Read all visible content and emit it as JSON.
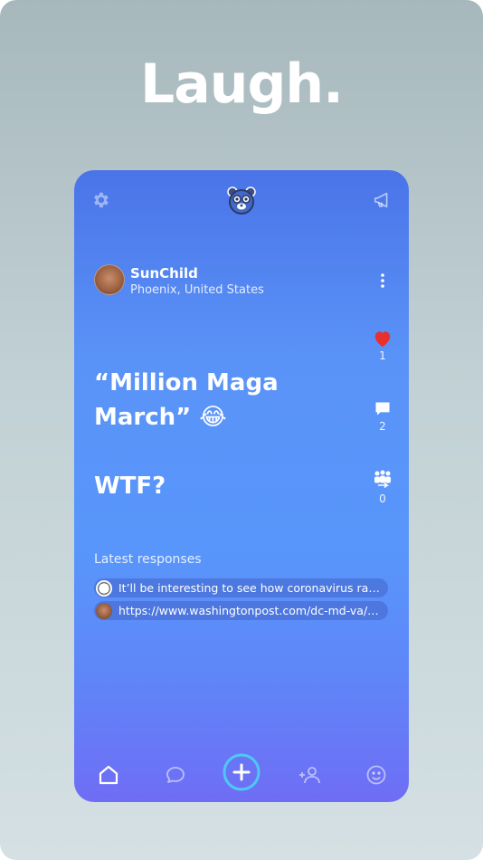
{
  "headline": "Laugh.",
  "topbar": {
    "left_icon": "gear-icon",
    "center_icon": "bear-logo-icon",
    "right_icon": "megaphone-icon"
  },
  "post": {
    "author": {
      "name": "SunChild",
      "location": "Phoenix, United States"
    },
    "text_line1": "“Million Maga",
    "text_line2": "March” 😂",
    "text_line3": "WTF?",
    "actions": {
      "likes": "1",
      "comments": "2",
      "groups": "0"
    }
  },
  "responses": {
    "label": "Latest responses",
    "items": [
      {
        "text": "It’ll be interesting to see how coronavirus rates among those attending…"
      },
      {
        "text": "https://www.washingtonpost.com/dc-md-va/2020/…"
      }
    ]
  },
  "nav": {
    "items": [
      "home-icon",
      "chat-icon",
      "add-icon",
      "add-friend-icon",
      "smile-icon"
    ]
  },
  "colors": {
    "accent": "#4ec9f5",
    "like": "#e8302e"
  }
}
